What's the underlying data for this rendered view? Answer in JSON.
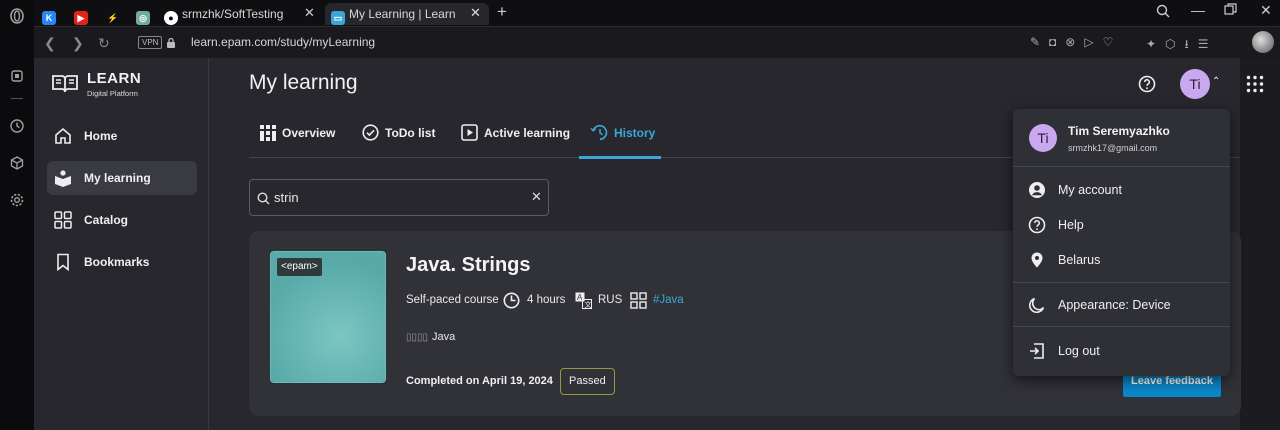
{
  "browser": {
    "tabs": [
      {
        "label": "",
        "icon": "vk-icon"
      },
      {
        "label": "",
        "icon": "youtube-icon"
      },
      {
        "label": "",
        "icon": "bolt-icon"
      },
      {
        "label": "",
        "icon": "chatgpt-icon"
      },
      {
        "label": "srmzhk/SoftTesting",
        "icon": "github-icon"
      },
      {
        "label": "My Learning | Learn",
        "icon": "learn-icon"
      }
    ],
    "vpn_badge": "VPN",
    "url": "learn.epam.com/study/myLearning"
  },
  "brand": {
    "title": "LEARN",
    "subtitle": "Digital Platform"
  },
  "sidebar": {
    "items": [
      {
        "label": "Home",
        "icon": "home-icon"
      },
      {
        "label": "My learning",
        "icon": "my-learning-icon",
        "active": true
      },
      {
        "label": "Catalog",
        "icon": "catalog-icon"
      },
      {
        "label": "Bookmarks",
        "icon": "bookmark-icon"
      }
    ]
  },
  "header": {
    "title": "My learning",
    "avatar_initials": "Ti"
  },
  "tabs": [
    {
      "label": "Overview"
    },
    {
      "label": "ToDo list"
    },
    {
      "label": "Active learning"
    },
    {
      "label": "History",
      "active": true
    }
  ],
  "search": {
    "value": "strin"
  },
  "course": {
    "thumb_badge": "<epam>",
    "title": "Java. Strings",
    "type": "Self-paced course",
    "duration": "4 hours",
    "language": "RUS",
    "tag": "#Java",
    "skill_prefix": "▯▯▯▯",
    "skill": "Java",
    "completed": "Completed on April 19, 2024",
    "status": "Passed",
    "feedback_button": "Leave feedback"
  },
  "user_menu": {
    "initials": "Ti",
    "name": "Tim Seremyazhko",
    "email": "srmzhk17@gmail.com",
    "items": [
      {
        "label": "My account",
        "icon": "account-icon"
      },
      {
        "label": "Help",
        "icon": "help-icon"
      },
      {
        "label": "Belarus",
        "icon": "location-pin-icon"
      },
      {
        "label": "Appearance: Device",
        "icon": "moon-icon"
      },
      {
        "label": "Log out",
        "icon": "logout-icon"
      }
    ]
  },
  "colors": {
    "accent": "#3ba7d9",
    "button": "#0b87c9",
    "avatar": "#c9a8f0",
    "thumb": "#5fb3b1"
  }
}
